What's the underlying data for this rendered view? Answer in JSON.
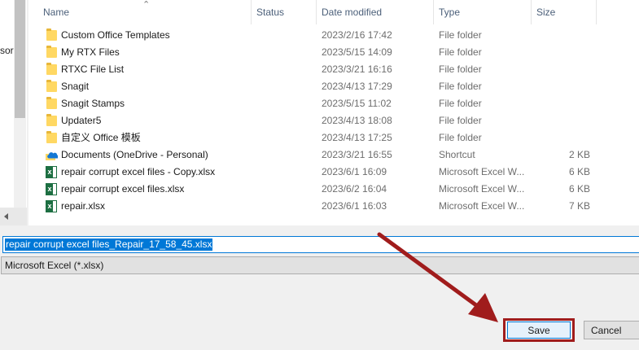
{
  "nav": {
    "partial_text": "sor"
  },
  "columns": {
    "name": "Name",
    "status": "Status",
    "date": "Date modified",
    "type": "Type",
    "size": "Size"
  },
  "files": [
    {
      "icon": "folder-icon",
      "name": "Custom Office Templates",
      "status": "synced-check-icon",
      "date": "2023/2/16 17:42",
      "type": "File folder",
      "size": ""
    },
    {
      "icon": "folder-icon",
      "name": "My RTX Files",
      "status": "synced-check-icon",
      "date": "2023/5/15 14:09",
      "type": "File folder",
      "size": ""
    },
    {
      "icon": "folder-icon",
      "name": "RTXC File List",
      "status": "sync-pending-icon",
      "date": "2023/3/21 16:16",
      "type": "File folder",
      "size": ""
    },
    {
      "icon": "folder-icon",
      "name": "Snagit",
      "status": "synced-check-icon",
      "date": "2023/4/13 17:29",
      "type": "File folder",
      "size": ""
    },
    {
      "icon": "folder-icon",
      "name": "Snagit Stamps",
      "status": "synced-check-icon",
      "date": "2023/5/15 11:02",
      "type": "File folder",
      "size": ""
    },
    {
      "icon": "folder-icon",
      "name": "Updater5",
      "status": "synced-check-icon",
      "date": "2023/4/13 18:08",
      "type": "File folder",
      "size": ""
    },
    {
      "icon": "folder-icon",
      "name": "自定义 Office 模板",
      "status": "synced-check-icon",
      "date": "2023/4/13 17:25",
      "type": "File folder",
      "size": ""
    },
    {
      "icon": "onedrive-shortcut-icon",
      "name": "Documents (OneDrive - Personal)",
      "status": "synced-check-icon",
      "date": "2023/3/21 16:55",
      "type": "Shortcut",
      "size": "2 KB"
    },
    {
      "icon": "excel-file-icon",
      "name": "repair corrupt excel files - Copy.xlsx",
      "status": "synced-check-icon",
      "date": "2023/6/1 16:09",
      "type": "Microsoft Excel W...",
      "size": "6 KB"
    },
    {
      "icon": "excel-file-icon",
      "name": "repair corrupt excel files.xlsx",
      "status": "synced-check-icon",
      "date": "2023/6/2 16:04",
      "type": "Microsoft Excel W...",
      "size": "6 KB"
    },
    {
      "icon": "excel-file-icon",
      "name": "repair.xlsx",
      "status": "synced-check-icon",
      "date": "2023/6/1 16:03",
      "type": "Microsoft Excel W...",
      "size": "7 KB"
    }
  ],
  "filename": {
    "value": "repair corrupt excel files_Repair_17_58_45.xlsx"
  },
  "file_type": {
    "selected": "Microsoft Excel (*.xlsx)"
  },
  "buttons": {
    "save": "Save",
    "cancel": "Cancel"
  },
  "colors": {
    "annotation": "#a01c1c",
    "selection": "#0078d7",
    "status_ok": "#1e8e3e",
    "status_sync": "#1a73e8"
  }
}
